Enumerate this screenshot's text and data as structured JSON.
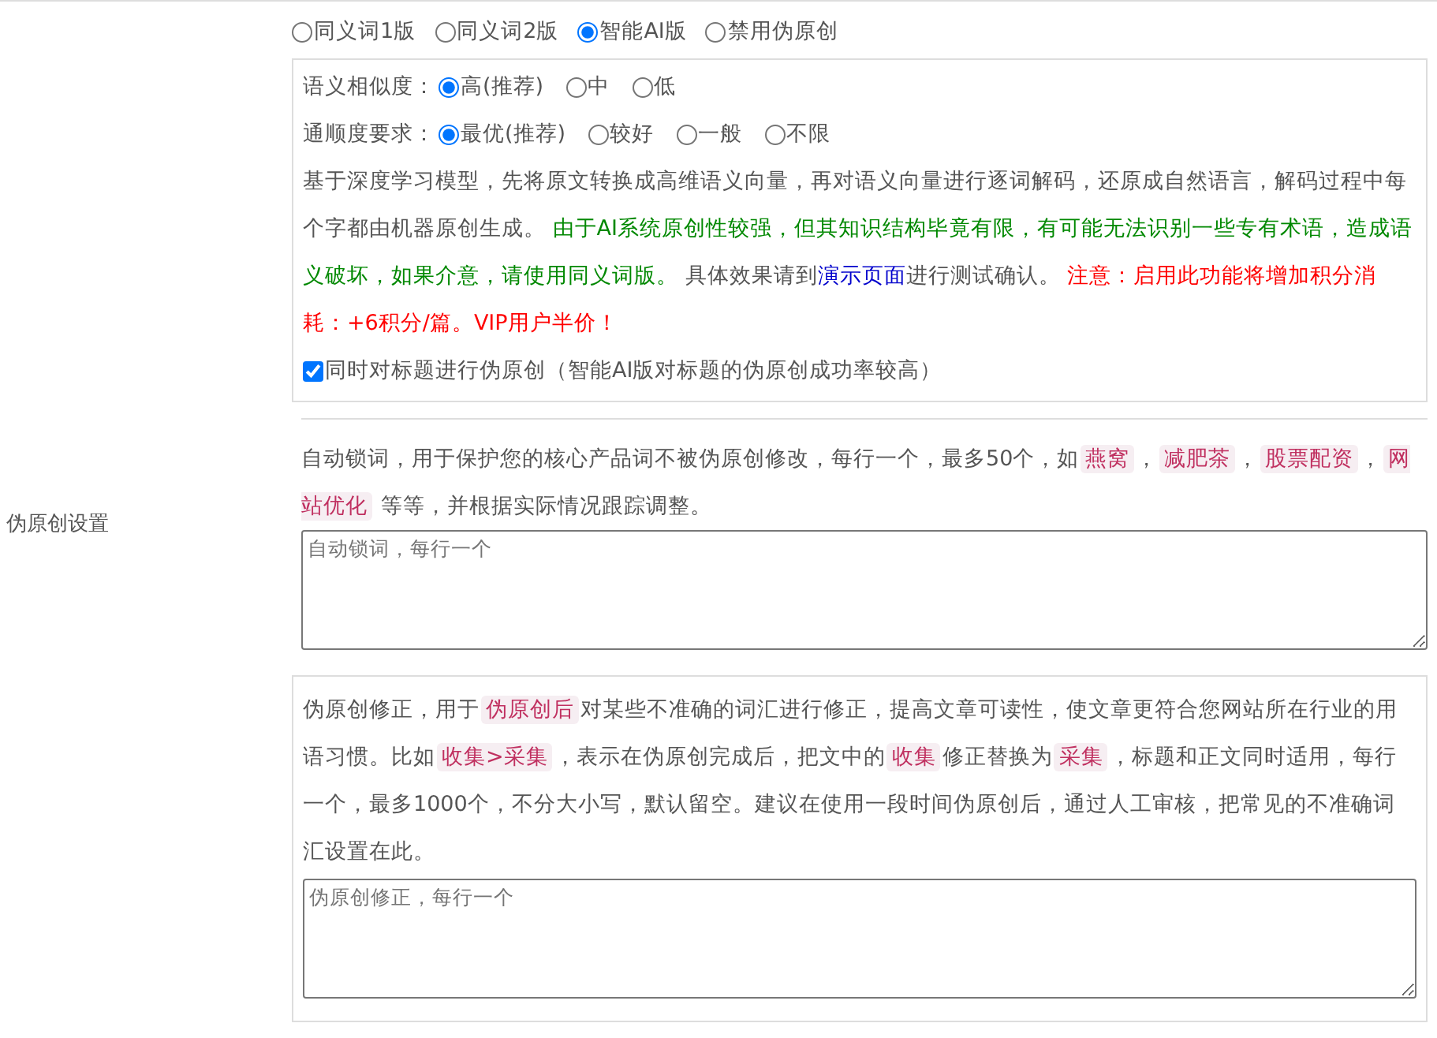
{
  "section_label": "伪原创设置",
  "modes": [
    {
      "label": "同义词1版",
      "selected": false
    },
    {
      "label": "同义词2版",
      "selected": false
    },
    {
      "label": "智能AI版",
      "selected": true
    },
    {
      "label": "禁用伪原创",
      "selected": false
    }
  ],
  "ai_settings": {
    "settings": [
      {
        "label": "语义相似度：",
        "options": [
          {
            "label": "高(推荐)",
            "selected": true
          },
          {
            "label": "中",
            "selected": false
          },
          {
            "label": "低",
            "selected": false
          }
        ]
      },
      {
        "label": "通顺度要求：",
        "options": [
          {
            "label": "最优(推荐)",
            "selected": true
          },
          {
            "label": "较好",
            "selected": false
          },
          {
            "label": "一般",
            "selected": false
          },
          {
            "label": "不限",
            "selected": false
          }
        ]
      }
    ],
    "description": [
      {
        "kind": "text",
        "text": "基于深度学习模型，先将原文转换成高维语义向量，再对语义向量进行逐词解码，还原成自然语言，解码过程中每个字都由机器原创生成。 "
      },
      {
        "kind": "notice",
        "text": "由于AI系统原创性较强，但其知识结构毕竟有限，有可能无法识别一些专有术语，造成语义破坏，如果介意，请使用同义词版。"
      },
      {
        "kind": "text",
        "text": " 具体效果请到"
      },
      {
        "kind": "link",
        "text": "演示页面"
      },
      {
        "kind": "text",
        "text": "进行测试确认。 "
      },
      {
        "kind": "warning",
        "text": "注意：启用此功能将增加积分消耗：+6积分/篇。VIP用户半价！"
      }
    ],
    "title_option": {
      "label": "同时对标题进行伪原创（智能AI版对标题的伪原创成功率较高）",
      "checked": true
    }
  },
  "lock_words": {
    "description": [
      {
        "kind": "text",
        "text": "自动锁词，用于保护您的核心产品词不被伪原创修改，每行一个，最多50个，如"
      },
      {
        "kind": "tag",
        "text": "燕窝"
      },
      {
        "kind": "text",
        "text": "，"
      },
      {
        "kind": "tag",
        "text": "减肥茶"
      },
      {
        "kind": "text",
        "text": "，"
      },
      {
        "kind": "tag",
        "text": "股票配资"
      },
      {
        "kind": "text",
        "text": "，"
      },
      {
        "kind": "tag",
        "text": "网站优化"
      },
      {
        "kind": "text",
        "text": " 等等，并根据实际情况跟踪调整。"
      }
    ],
    "placeholder": "自动锁词，每行一个"
  },
  "correction": {
    "description": [
      {
        "kind": "text",
        "text": "伪原创修正，用于"
      },
      {
        "kind": "tag",
        "text": "伪原创后"
      },
      {
        "kind": "text",
        "text": "对某些不准确的词汇进行修正，提高文章可读性，使文章更符合您网站所在行业的用语习惯。比如"
      },
      {
        "kind": "tag",
        "text": "收集>采集"
      },
      {
        "kind": "text",
        "text": "，表示在伪原创完成后，把文中的"
      },
      {
        "kind": "tag",
        "text": "收集"
      },
      {
        "kind": "text",
        "text": "修正替换为"
      },
      {
        "kind": "tag",
        "text": "采集"
      },
      {
        "kind": "text",
        "text": "，标题和正文同时适用，每行一个，最多1000个，不分大小写，默认留空。建议在使用一段时间伪原创后，通过人工审核，把常见的不准确词汇设置在此。"
      }
    ],
    "placeholder": "伪原创修正，每行一个"
  }
}
